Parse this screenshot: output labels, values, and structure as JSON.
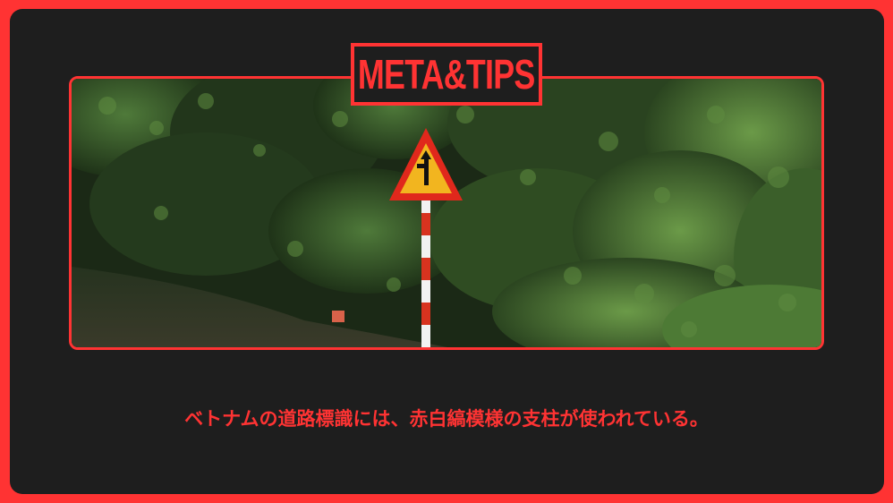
{
  "brand": {
    "title": "META&TIPS"
  },
  "caption": {
    "text": "ベトナムの道路標識には、赤白縞模様の支柱が使われている。"
  },
  "photo": {
    "sign_icon": "side-road-junction-warning-icon",
    "post_icon": "red-white-striped-pole-icon"
  },
  "colors": {
    "accent": "#ff3333",
    "card_background": "#1e1e1e",
    "sign_yellow": "#f2b51f",
    "sign_red": "#e0281c"
  }
}
